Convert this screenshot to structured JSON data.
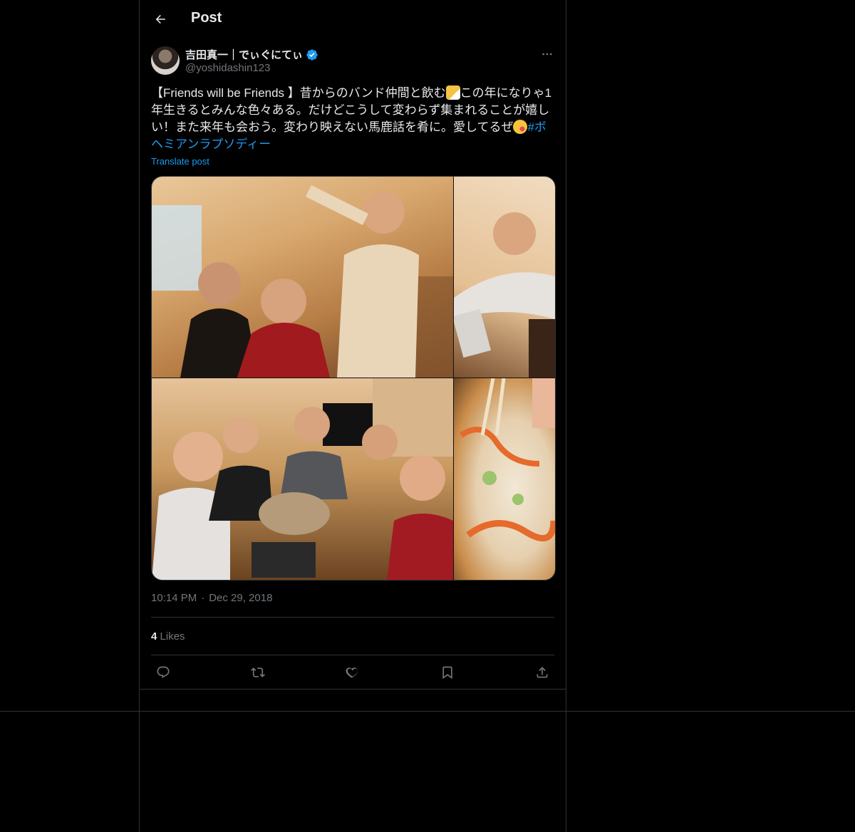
{
  "header": {
    "title": "Post"
  },
  "author": {
    "display_name": "吉田真一｜でぃぐにてぃ",
    "handle": "@yoshidashin123",
    "verified": true
  },
  "tweet": {
    "text_part1": "【Friends will be Friends 】昔からのバンド仲間と飲む",
    "emoji1": "beer-mugs-emoji",
    "text_part2": "この年になりゃ1年生きるとみんな色々ある。だけどこうして変わらず集まれることが嬉しい！また来年も会おう。変わり映えない馬鹿話を肴に。愛してるぜ",
    "emoji2": "face-blowing-kiss-emoji",
    "hashtag": "#ボヘミアンラプソディー",
    "translate_label": "Translate post"
  },
  "timestamp": {
    "time": "10:14 PM",
    "dot": "·",
    "date": "Dec 29, 2018"
  },
  "stats": {
    "likes_count": "4",
    "likes_label": "Likes"
  },
  "actions": [
    "reply-icon",
    "repost-icon",
    "like-icon",
    "bookmark-icon",
    "share-icon"
  ],
  "colors": {
    "background": "#000000",
    "accent": "#1d9bf0",
    "text": "#e7e9ea",
    "muted": "#71767b",
    "border": "#2f3336"
  }
}
